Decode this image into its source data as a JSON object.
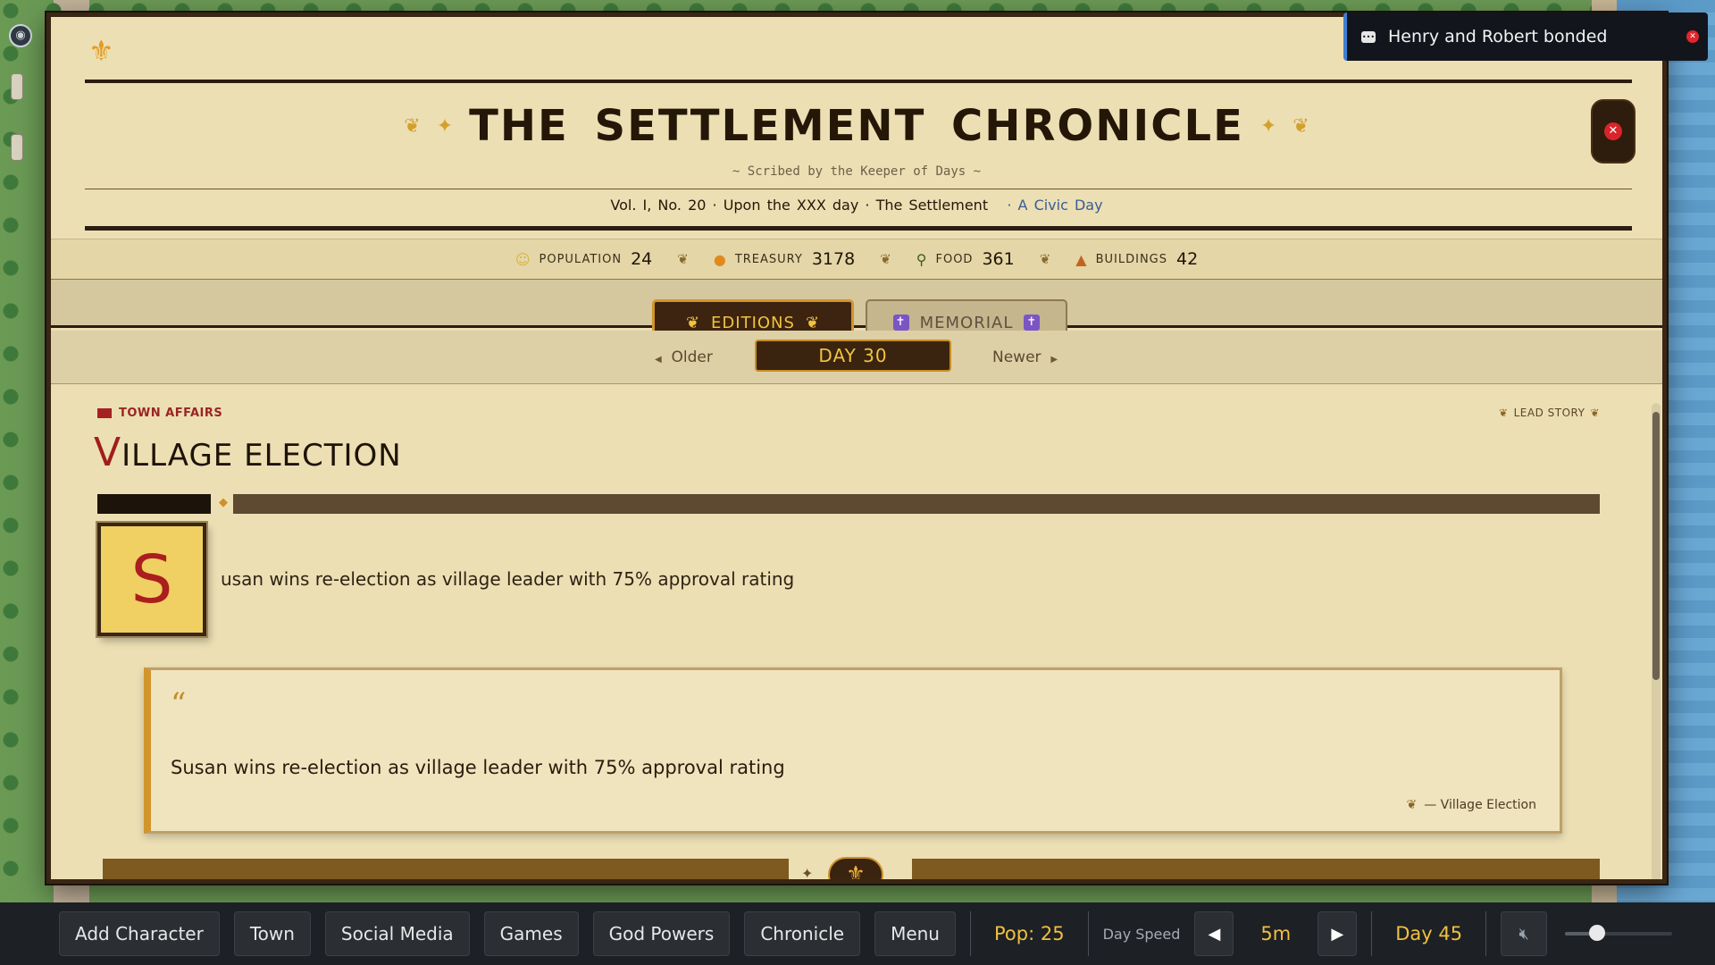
{
  "notification": {
    "text": "Henry and Robert bonded"
  },
  "chronicle": {
    "title": "THE SETTLEMENT CHRONICLE",
    "subtitle": "~ Scribed by the Keeper of Days ~",
    "volume_line": "Vol. I, No. 20 · Upon the XXX day · The Settlement",
    "day_flavor": "· A Civic Day",
    "stats": [
      {
        "label": "POPULATION",
        "value": "24",
        "icon": "people-icon"
      },
      {
        "label": "TREASURY",
        "value": "3178",
        "icon": "coin-icon"
      },
      {
        "label": "FOOD",
        "value": "361",
        "icon": "food-icon"
      },
      {
        "label": "BUILDINGS",
        "value": "42",
        "icon": "buildings-icon"
      }
    ],
    "tabs": {
      "editions": "EDITIONS",
      "memorial": "MEMORIAL"
    },
    "nav": {
      "older": "Older",
      "newer": "Newer",
      "day": "DAY 30"
    },
    "article": {
      "section": "TOWN AFFAIRS",
      "lead_tag": "LEAD STORY",
      "headline_cap": "V",
      "headline_rest": "ILLAGE ELECTION",
      "dropcap": "S",
      "lede": "usan wins re-election as village leader with 75% approval rating",
      "quote": "Susan wins re-election as village leader with 75% approval rating",
      "citation": "— Village Election"
    }
  },
  "bottombar": {
    "buttons": [
      "Add Character",
      "Town",
      "Social Media",
      "Games",
      "God Powers",
      "Chronicle",
      "Menu"
    ],
    "population": "Pop: 25",
    "day_speed_label": "Day Speed",
    "speed": "5m",
    "day": "Day 45",
    "volume_level": 0.3
  },
  "colors": {
    "accent_gold": "#f1c33e",
    "headline_red": "#a11d1d",
    "parchment": "#ecdfb4",
    "bar_dark": "#1d2024"
  }
}
